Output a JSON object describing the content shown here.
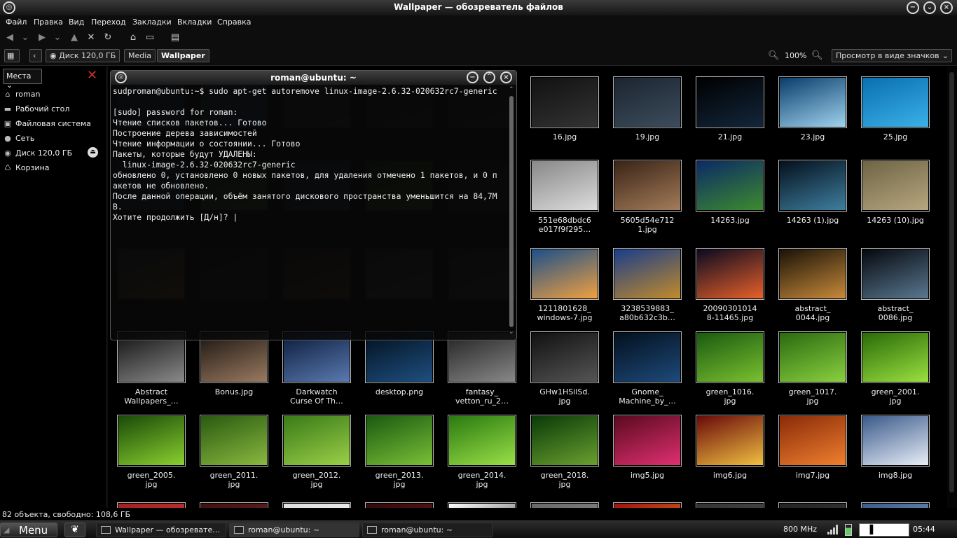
{
  "window": {
    "title": "Wallpaper — обозреватель файлов"
  },
  "menu": [
    "Файл",
    "Правка",
    "Вид",
    "Переход",
    "Закладки",
    "Вкладки",
    "Справка"
  ],
  "breadcrumbs": [
    "Диск 120,0 ГБ",
    "Media",
    "Wallpaper"
  ],
  "zoom": "100%",
  "view_mode": "Просмотр в виде значков",
  "places": {
    "selector": "Места",
    "items": [
      "roman",
      "Рабочий стол",
      "Файловая система",
      "Сеть",
      "Диск 120,0 ГБ",
      "Корзина"
    ]
  },
  "terminal": {
    "title": "roman@ubuntu: ~",
    "lines": [
      "sudproman@ubuntu:~$ sudo apt-get autoremove linux-image-2.6.32-020632rc7-generic",
      "",
      "[sudo] password for roman:",
      "Чтение списков пакетов... Готово",
      "Построение дерева зависимостей",
      "Чтение информации о состоянии... Готово",
      "Пакеты, которые будут УДАЛЕНЫ:",
      "  linux-image-2.6.32-020632rc7-generic",
      "обновлено 0, установлено 0 новых пакетов, для удаления отмечено 1 пакетов, и 0 п",
      "акетов не обновлено.",
      "После данной операции, объём занятого дискового пространства уменьшится на 84,7М",
      "В.",
      "Хотите продолжить [Д/н]? |"
    ]
  },
  "files": [
    {
      "name": "16.jpg",
      "c": [
        "#111",
        "#333"
      ]
    },
    {
      "name": "19.jpg",
      "c": [
        "#1b2530",
        "#3d4c5c"
      ]
    },
    {
      "name": "21.jpg",
      "c": [
        "#000",
        "#13263c"
      ]
    },
    {
      "name": "23.jpg",
      "c": [
        "#0a3c6a",
        "#9fd3ee"
      ]
    },
    {
      "name": "25.jpg",
      "c": [
        "#0a6fb0",
        "#3ab0e8"
      ]
    },
    {
      "name": "551e68dbdc6\ne017f9f295…",
      "c": [
        "#888",
        "#ddd"
      ]
    },
    {
      "name": "5605d54e712\n1.jpg",
      "c": [
        "#3a2416",
        "#a47c5a"
      ]
    },
    {
      "name": "14263.jpg",
      "c": [
        "#0b2a66",
        "#3d8b2e"
      ]
    },
    {
      "name": "14263 (1).jpg",
      "c": [
        "#04101c",
        "#3f7fa0"
      ]
    },
    {
      "name": "14263 (10).jpg",
      "c": [
        "#6e6444",
        "#b7a780"
      ]
    },
    {
      "name": "1211801628_\nwindows-7.jpg",
      "c": [
        "#1c4f8a",
        "#f0a040"
      ]
    },
    {
      "name": "3238539883_\na80b632c3b…",
      "c": [
        "#1a3d8a",
        "#c28b2a"
      ]
    },
    {
      "name": "20090301014\n8-11465.jpg",
      "c": [
        "#0a0a20",
        "#e8602a"
      ]
    },
    {
      "name": "abstract_\n0044.jpg",
      "c": [
        "#1a1208",
        "#c88a3a"
      ]
    },
    {
      "name": "abstract_\n0086.jpg",
      "c": [
        "#05080e",
        "#5a7890"
      ]
    },
    {
      "name": "Abstract\nWallpapers_…",
      "c": [
        "#111",
        "#8a8a8a"
      ]
    },
    {
      "name": "Bonus.jpg",
      "c": [
        "#1a1410",
        "#9a7a60"
      ]
    },
    {
      "name": "Darkwatch\nCurse Of Th…",
      "c": [
        "#0a1a3a",
        "#5a7ab0"
      ]
    },
    {
      "name": "desktop.png",
      "c": [
        "#02101e",
        "#1f4f80"
      ]
    },
    {
      "name": "fantasy_\nvetton_ru_2…",
      "c": [
        "#222",
        "#888"
      ]
    },
    {
      "name": "GHw1HSilSd.\njpg",
      "c": [
        "#111",
        "#555"
      ]
    },
    {
      "name": "Gnome_\nMachine_by_…",
      "c": [
        "#03101e",
        "#1e4a7a"
      ]
    },
    {
      "name": "green_1016.\njpg",
      "c": [
        "#1a5a10",
        "#7ac030"
      ]
    },
    {
      "name": "green_1017.\njpg",
      "c": [
        "#2a6a10",
        "#8ad040"
      ]
    },
    {
      "name": "green_2001.\njpg",
      "c": [
        "#2a6a08",
        "#9ae040"
      ]
    },
    {
      "name": "green_2005.\njpg",
      "c": [
        "#1a4a08",
        "#8ad030"
      ]
    },
    {
      "name": "green_2011.\njpg",
      "c": [
        "#2a5a10",
        "#8ab840"
      ]
    },
    {
      "name": "green_2012.\njpg",
      "c": [
        "#3a7a18",
        "#9ad048"
      ]
    },
    {
      "name": "green_2013.\njpg",
      "c": [
        "#1a5a10",
        "#7ac038"
      ]
    },
    {
      "name": "green_2014.\njpg",
      "c": [
        "#2a7a10",
        "#9ae048"
      ]
    },
    {
      "name": "green_2018.\njpg",
      "c": [
        "#0a3a08",
        "#6aa030"
      ]
    },
    {
      "name": "img5.jpg",
      "c": [
        "#5a0a20",
        "#e03070"
      ]
    },
    {
      "name": "img6.jpg",
      "c": [
        "#6a0a0a",
        "#f0c040"
      ]
    },
    {
      "name": "img7.jpg",
      "c": [
        "#8a2a08",
        "#f08030"
      ]
    },
    {
      "name": "img8.jpg",
      "c": [
        "#3a5a8a",
        "#e8eef8"
      ]
    }
  ],
  "blurred_files": [
    {
      "name": "",
      "c": [
        "#223344",
        "#3a5a80"
      ]
    },
    {
      "name": "",
      "c": [
        "#224466",
        "#3a6aa0"
      ]
    },
    {
      "name": "",
      "c": [
        "#333",
        "#555"
      ]
    },
    {
      "name": "",
      "c": [
        "#222",
        "#444"
      ]
    },
    {
      "name": "",
      "c": [
        "#223",
        "#445"
      ]
    },
    {
      "name": "",
      "c": [
        "#1a3050",
        "#2a5080"
      ]
    },
    {
      "name": "",
      "c": [
        "#2a5a20",
        "#5a9a40"
      ]
    },
    {
      "name": "",
      "c": [
        "#203850",
        "#305a80"
      ]
    },
    {
      "name": "",
      "c": [
        "#2a5a18",
        "#5a9a30"
      ]
    },
    {
      "name": "",
      "c": [
        "#223",
        "#335"
      ]
    },
    {
      "name": "",
      "c": [
        "#3a4a6a",
        "#d09040"
      ]
    },
    {
      "name": "",
      "c": [
        "#222",
        "#333"
      ]
    },
    {
      "name": "",
      "c": [
        "#3a2a18",
        "#a07040"
      ]
    },
    {
      "name": "",
      "c": [
        "#444",
        "#777"
      ]
    },
    {
      "name": "",
      "c": [
        "#333",
        "#666"
      ]
    }
  ],
  "bottom_partial": [
    {
      "c": [
        "#a02020",
        "#e04040"
      ]
    },
    {
      "c": [
        "#401010",
        "#803030"
      ]
    },
    {
      "c": [
        "#ddd",
        "#fff"
      ]
    },
    {
      "c": [
        "#300a0a",
        "#802020"
      ]
    },
    {
      "c": [
        "#fff",
        "#111"
      ]
    },
    {
      "c": [
        "#666",
        "#999"
      ]
    },
    {
      "c": [
        "#a01010",
        "#f0a020"
      ]
    },
    {
      "c": [
        "#333",
        "#555"
      ]
    },
    {
      "c": [
        "#222",
        "#444"
      ]
    },
    {
      "c": [
        "#3a5a8a",
        "#8ab0d0"
      ]
    }
  ],
  "status": "82 объекта, свободно: 108,6 ГБ",
  "taskbar": {
    "menu": "Menu",
    "tasks": [
      "Wallpaper — обозревате…",
      "roman@ubuntu: ~",
      "roman@ubuntu: ~"
    ],
    "cpu": "800 MHz",
    "clock": "05:44"
  }
}
